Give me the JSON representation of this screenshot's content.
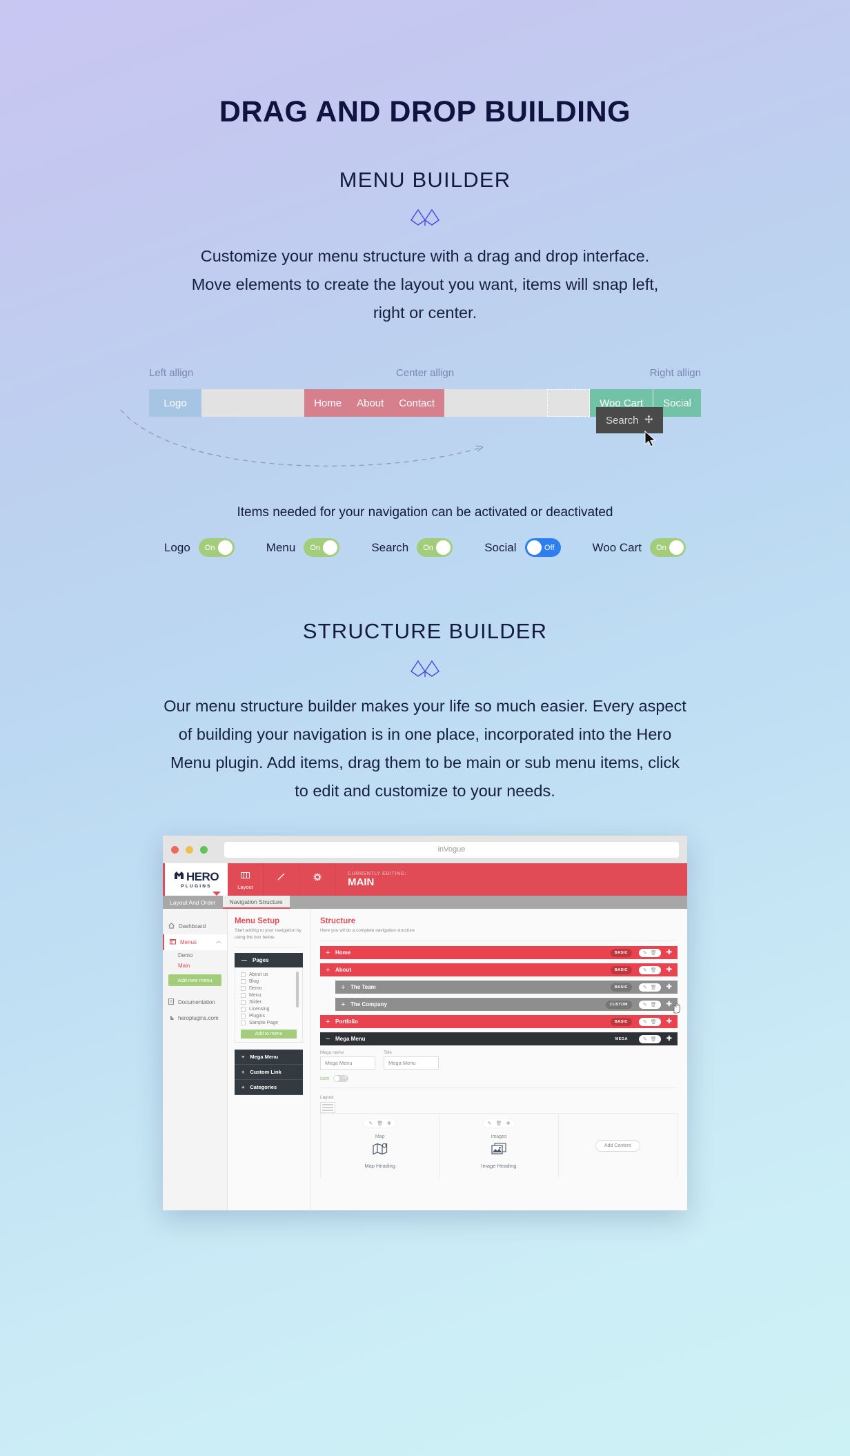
{
  "hero": {
    "title": "DRAG AND DROP BUILDING"
  },
  "menu_builder": {
    "title": "MENU BUILDER",
    "paragraph": "Customize your menu structure with a drag and drop interface. Move elements to create the layout you want, items will snap left, right or center."
  },
  "navdemo": {
    "align_left": "Left allign",
    "align_center": "Center allign",
    "align_right": "Right allign",
    "logo": "Logo",
    "center_items": [
      "Home",
      "About",
      "Contact"
    ],
    "right_items": [
      "Woo Cart",
      "Social"
    ],
    "drag_chip": "Search",
    "colors": {
      "logo": "#a6c4e3",
      "center": "#d6808e",
      "right": "#72c2a7",
      "track": "#e2e2e2",
      "chip": "#4a4a4a"
    }
  },
  "toggles": {
    "caption": "Items needed for your navigation can be activated or deactivated",
    "items": [
      {
        "label": "Logo",
        "state": "On"
      },
      {
        "label": "Menu",
        "state": "On"
      },
      {
        "label": "Search",
        "state": "On"
      },
      {
        "label": "Social",
        "state": "Off"
      },
      {
        "label": "Woo Cart",
        "state": "On"
      }
    ]
  },
  "structure_builder": {
    "title": "STRUCTURE BUILDER",
    "paragraph": "Our menu structure builder makes your life so much easier. Every aspect of building your navigation is in one place, incorporated into the Hero Menu plugin. Add items, drag them to be main or sub menu items, click to edit and customize to your needs."
  },
  "browser": {
    "url": "inVogue",
    "brand": {
      "name": "HERO",
      "sub": "PLUGINS"
    },
    "header_buttons": [
      {
        "label": "Layout",
        "icon": "layout-icon"
      },
      {
        "label": "",
        "icon": "pencil-icon"
      },
      {
        "label": "",
        "icon": "gear-icon"
      }
    ],
    "editing": {
      "eyebrow": "CURRENTLY EDITING:",
      "value": "MAIN"
    },
    "tabs": [
      {
        "label": "Layout And Order",
        "active": false
      },
      {
        "label": "Navigation Structure",
        "active": true
      }
    ],
    "sidebar": {
      "dashboard": "Dashboard",
      "menus": "Menus",
      "submenus": [
        "Demo",
        "Main"
      ],
      "add_button": "Add new menu",
      "documentation": "Documentation",
      "website": "heroplugins.com"
    },
    "menu_setup": {
      "heading": "Menu Setup",
      "description": "Start adding to your navigation by using the box below.",
      "accordion": "Pages",
      "pages": [
        "About us",
        "Blog",
        "Demo",
        "Menu",
        "Slider",
        "Licensing",
        "Plugins",
        "Sample Page"
      ],
      "add_to_menu": "Add to menu",
      "dark_buttons": [
        "Mega Menu",
        "Custom Link",
        "Categories"
      ]
    },
    "structure": {
      "heading": "Structure",
      "description": "Here you wil do a complete navigation structure",
      "rows": [
        {
          "name": "Home",
          "badge": "BASIC",
          "type": "main",
          "toggle": "+"
        },
        {
          "name": "About",
          "badge": "BASIC",
          "type": "main",
          "toggle": "+"
        },
        {
          "name": "The Team",
          "badge": "BASIC",
          "type": "sub",
          "toggle": "+"
        },
        {
          "name": "The Company",
          "badge": "CUSTOM",
          "type": "sub",
          "toggle": "+"
        },
        {
          "name": "Portfolio",
          "badge": "BASIC",
          "type": "main",
          "toggle": "+"
        },
        {
          "name": "Mega Menu",
          "badge": "MEGA",
          "type": "mega",
          "toggle": "−"
        }
      ],
      "fields": [
        {
          "label": "Mega name",
          "value": "Mega Menu"
        },
        {
          "label": "Title",
          "value": "Mega Menu"
        }
      ],
      "icon_label": "Icon",
      "icon_state": "Off",
      "layout_label": "Layout",
      "blocks": [
        {
          "title": "Map",
          "heading": "Map Heading",
          "icon": "map-icon"
        },
        {
          "title": "Images",
          "heading": "Image Heading",
          "icon": "image-icon"
        }
      ],
      "add_content": "Add Content"
    }
  }
}
